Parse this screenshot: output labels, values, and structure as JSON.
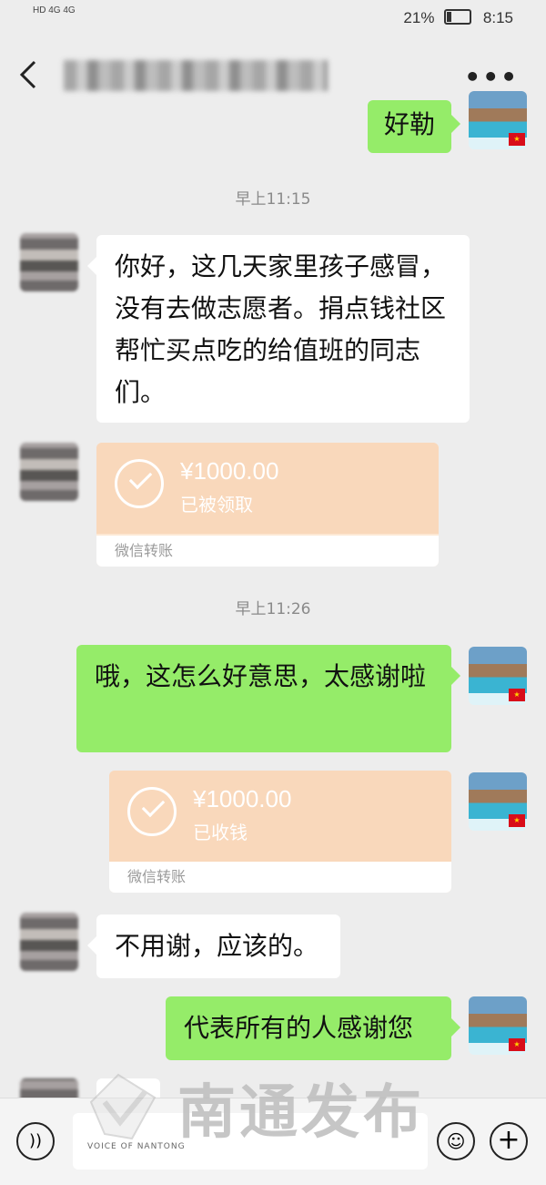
{
  "status_bar": {
    "network_left": "HD 4G 4G",
    "battery_percent": "21%",
    "battery_level": 0.21,
    "time": "8:15"
  },
  "nav": {
    "back_icon": "chevron-left-icon",
    "more_label": "•••"
  },
  "messages": {
    "m0": {
      "text": "好勒"
    },
    "t1": "早上11:15",
    "m1": {
      "text": "你好，这几天家里孩子感冒，没有去做志愿者。捐点钱社区帮忙买点吃的给值班的同志们。"
    },
    "m2": {
      "amount": "¥1000.00",
      "state": "已被领取",
      "footer": "微信转账"
    },
    "t2": "早上11:26",
    "m3": {
      "text": "哦，这怎么好意思，太感谢啦"
    },
    "m4": {
      "amount": "¥1000.00",
      "state": "已收钱",
      "footer": "微信转账"
    },
    "m5": {
      "text": "不用谢，应该的。"
    },
    "m6": {
      "text": "代表所有的人感谢您"
    }
  },
  "watermark": {
    "name": "南通发布",
    "sub": "VOICE OF NANTONG"
  },
  "input_bar": {
    "voice_icon": "voice-icon",
    "emoji_icon": "emoji-icon",
    "plus_icon": "plus-icon"
  },
  "colors": {
    "background": "#ededed",
    "self_bubble": "#95ec69",
    "other_bubble": "#ffffff",
    "transfer": "#f9d8bb"
  }
}
